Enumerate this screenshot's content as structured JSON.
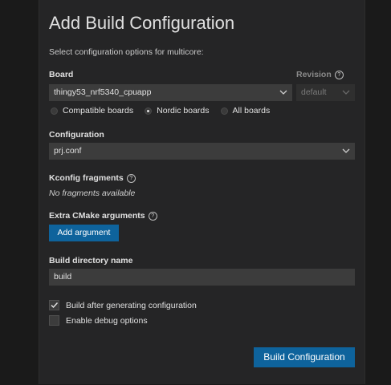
{
  "dialog": {
    "title": "Add Build Configuration",
    "subtitle": "Select configuration options for multicore:"
  },
  "board": {
    "label": "Board",
    "value": "thingy53_nrf5340_cpuapp",
    "filter_options": [
      {
        "label": "Compatible boards",
        "selected": false
      },
      {
        "label": "Nordic boards",
        "selected": true
      },
      {
        "label": "All boards",
        "selected": false
      }
    ]
  },
  "revision": {
    "label": "Revision",
    "info_glyph": "?",
    "value": "default"
  },
  "configuration": {
    "label": "Configuration",
    "value": "prj.conf"
  },
  "kconfig": {
    "label": "Kconfig fragments",
    "info_glyph": "?",
    "empty_text": "No fragments available"
  },
  "cmake": {
    "label": "Extra CMake arguments",
    "info_glyph": "?",
    "add_button": "Add argument"
  },
  "build_dir": {
    "label": "Build directory name",
    "value": "build"
  },
  "options": {
    "build_after": {
      "label": "Build after generating configuration",
      "checked": true
    },
    "debug": {
      "label": "Enable debug options",
      "checked": false
    }
  },
  "footer": {
    "build_button": "Build Configuration"
  },
  "colors": {
    "accent": "#0e639c",
    "panel": "#252526",
    "field": "#3c3c3c"
  }
}
